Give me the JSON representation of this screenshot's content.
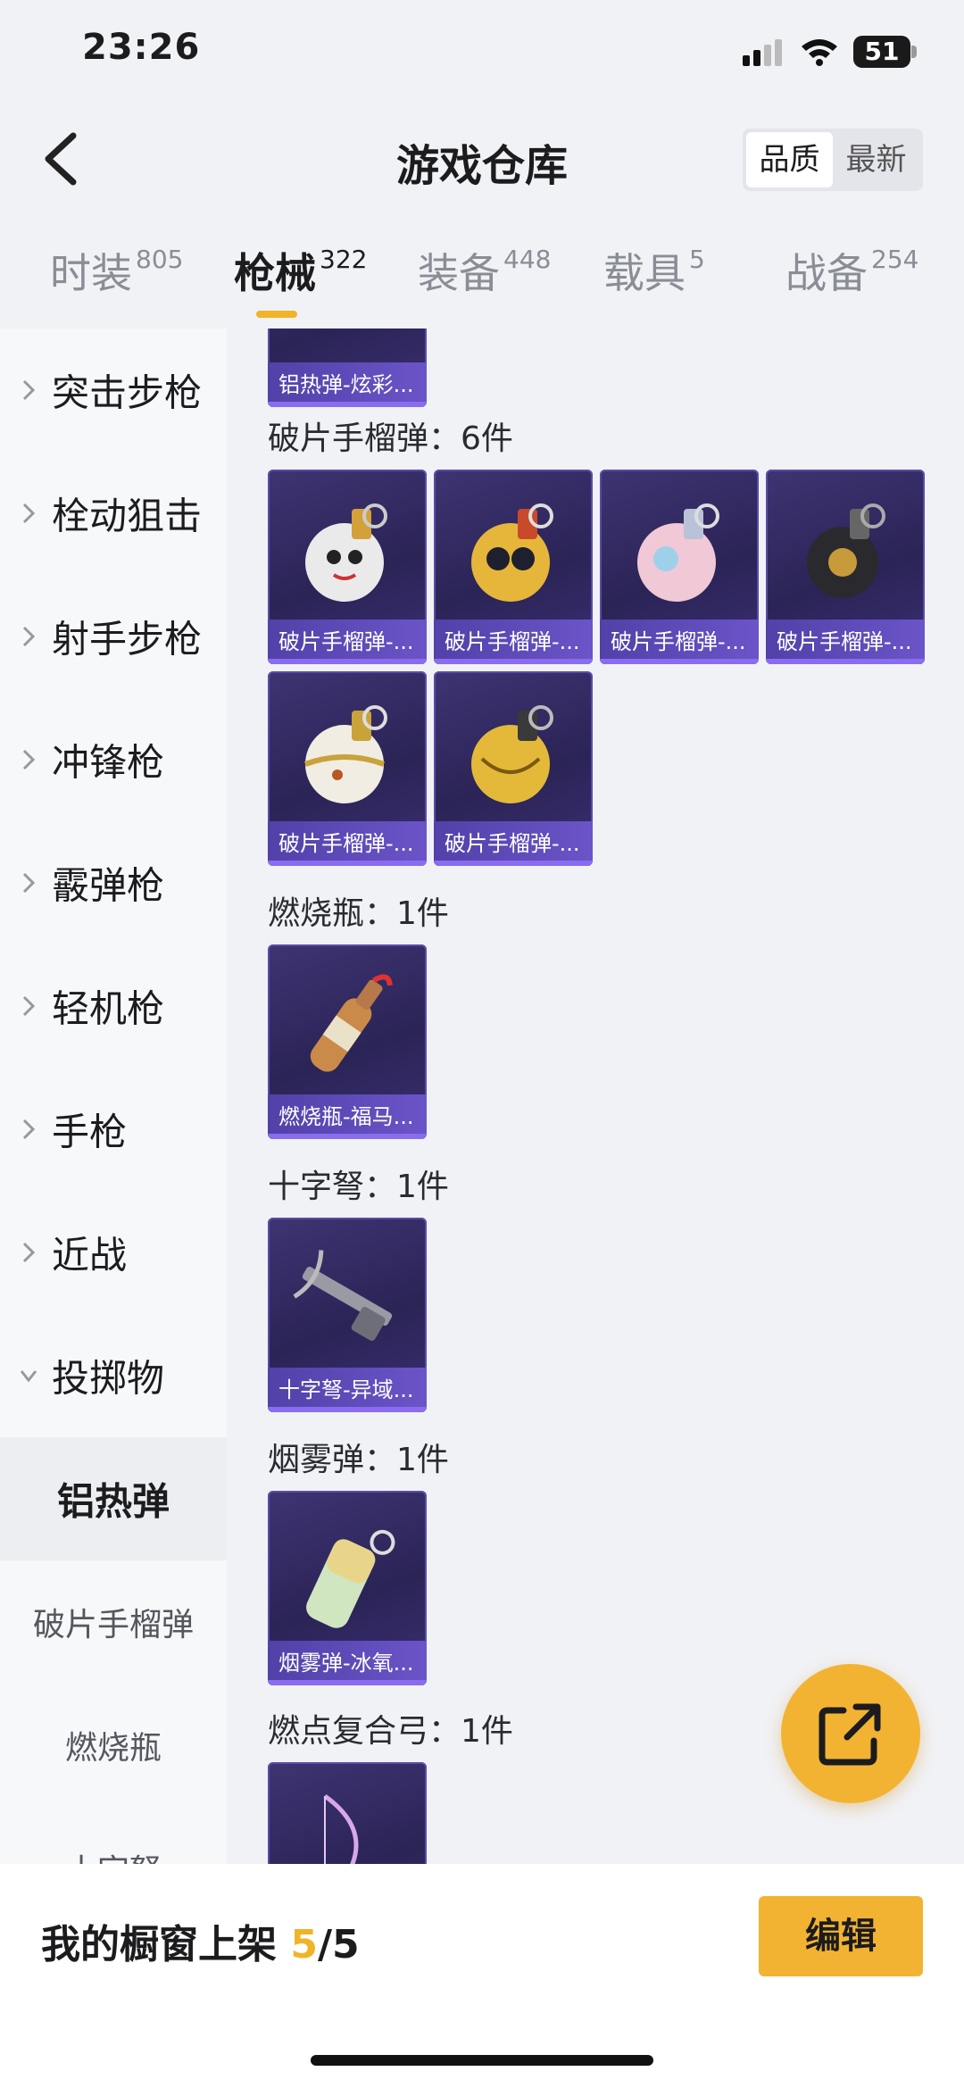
{
  "status_bar": {
    "time": "23:26",
    "battery": "51"
  },
  "header": {
    "title": "游戏仓库",
    "sort_options": [
      "品质",
      "最新"
    ]
  },
  "tabs": [
    {
      "label": "时装",
      "count": "805"
    },
    {
      "label": "枪械",
      "count": "322"
    },
    {
      "label": "装备",
      "count": "448"
    },
    {
      "label": "载具",
      "count": "5"
    },
    {
      "label": "战备",
      "count": "254"
    }
  ],
  "sidebar": {
    "categories": [
      "突击步枪",
      "栓动狙击",
      "射手步枪",
      "冲锋枪",
      "霰弹枪",
      "轻机枪",
      "手枪",
      "近战",
      "投掷物"
    ],
    "subcategories": [
      "铝热弹",
      "破片手榴弹",
      "燃烧瓶",
      "十字弩"
    ]
  },
  "content": {
    "top_partial_card": "铝热弹-炫彩...",
    "sections": [
      {
        "label": "破片手榴弹：6件",
        "items": [
          "破片手榴弹-...",
          "破片手榴弹-...",
          "破片手榴弹-...",
          "破片手榴弹-...",
          "破片手榴弹-...",
          "破片手榴弹-..."
        ]
      },
      {
        "label": "燃烧瓶：1件",
        "items": [
          "燃烧瓶-福马..."
        ]
      },
      {
        "label": "十字弩：1件",
        "items": [
          "十字弩-异域..."
        ]
      },
      {
        "label": "烟雾弹：1件",
        "items": [
          "烟雾弹-冰氧..."
        ]
      },
      {
        "label": "燃点复合弓：1件",
        "items": []
      }
    ]
  },
  "bottom_bar": {
    "label": "我的橱窗上架",
    "count": "5",
    "total": "/5",
    "edit_label": "编辑"
  },
  "colors": {
    "accent": "#f3b332",
    "card_bg": "#2b2456",
    "card_bar": "#6b54c8"
  }
}
